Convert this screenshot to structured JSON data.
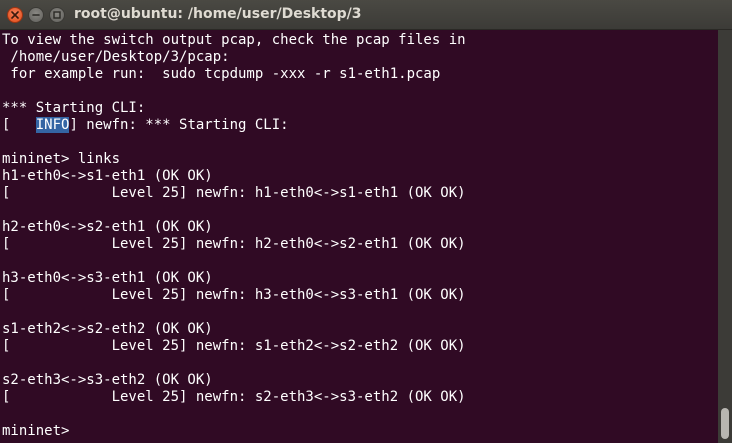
{
  "window": {
    "title": "root@ubuntu: /home/user/Desktop/3",
    "icons": {
      "close": "close-icon",
      "minimize": "minimize-icon",
      "maximize": "maximize-icon"
    }
  },
  "terminal": {
    "background": "#300a24",
    "foreground": "#ffffff",
    "highlight": "#3465a4",
    "lines": {
      "l0": "To view the switch output pcap, check the pcap files in",
      "l1": " /home/user/Desktop/3/pcap:",
      "l2": " for example run:  sudo tcpdump -xxx -r s1-eth1.pcap",
      "l4": "*** Starting CLI:",
      "l5_prefix": "[   ",
      "l5_highlight": "INFO",
      "l5_suffix": "] newfn: *** Starting CLI:",
      "l7": "mininet> links",
      "l8": "h1-eth0<->s1-eth1 (OK OK)",
      "l9": "[            Level 25] newfn: h1-eth0<->s1-eth1 (OK OK)",
      "l11": "h2-eth0<->s2-eth1 (OK OK)",
      "l12": "[            Level 25] newfn: h2-eth0<->s2-eth1 (OK OK)",
      "l14": "h3-eth0<->s3-eth1 (OK OK)",
      "l15": "[            Level 25] newfn: h3-eth0<->s3-eth1 (OK OK)",
      "l17": "s1-eth2<->s2-eth2 (OK OK)",
      "l18": "[            Level 25] newfn: s1-eth2<->s2-eth2 (OK OK)",
      "l20": "s2-eth3<->s3-eth2 (OK OK)",
      "l21": "[            Level 25] newfn: s2-eth3<->s3-eth2 (OK OK)",
      "l23": "mininet> "
    }
  }
}
